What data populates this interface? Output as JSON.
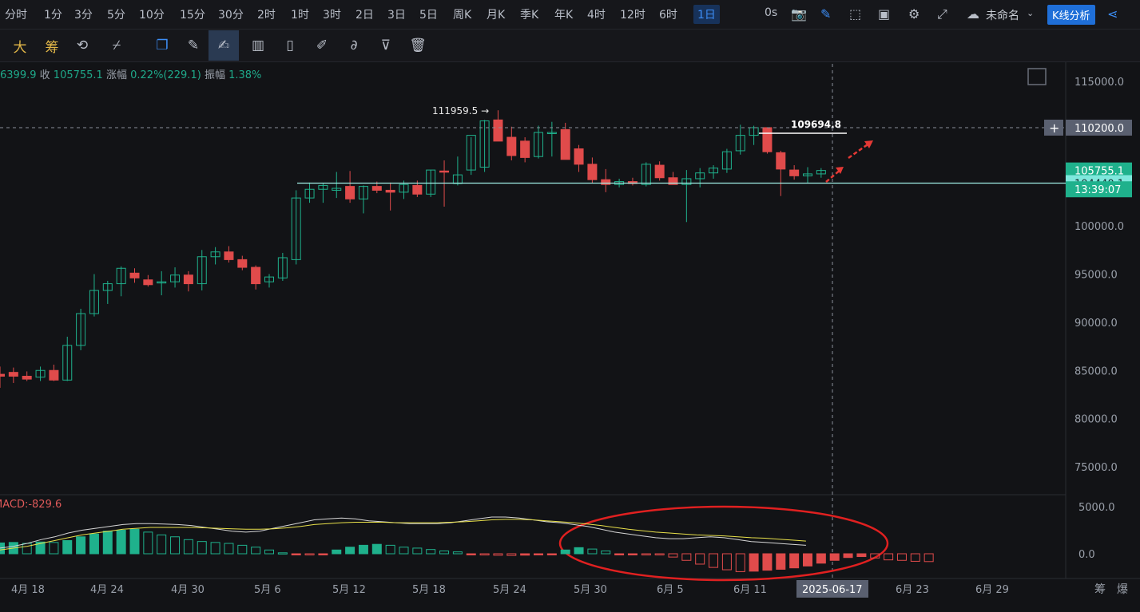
{
  "periods": [
    "分时",
    "1分",
    "3分",
    "5分",
    "10分",
    "15分",
    "30分",
    "2时",
    "1时",
    "3时",
    "2日",
    "3日",
    "5日",
    "周K",
    "月K",
    "季K",
    "年K",
    "4时",
    "12时",
    "6时",
    "1日"
  ],
  "active_period": "1日",
  "countdown": "0s",
  "layout_name": "未命名",
  "analysis_button": "K线分析",
  "tools": [
    {
      "name": "big-font-tool",
      "glyph": "大"
    },
    {
      "name": "chip-tool",
      "glyph": "筹"
    },
    {
      "name": "refresh-tool",
      "glyph": "⟲"
    },
    {
      "name": "crosshair-tool",
      "glyph": "⌿"
    },
    {
      "name": "copy-tool",
      "glyph": "❐"
    },
    {
      "name": "ruler-tool",
      "glyph": "✎"
    },
    {
      "name": "draw-line-tool",
      "glyph": "✍"
    },
    {
      "name": "candles-tool",
      "glyph": "▥"
    },
    {
      "name": "position-tool",
      "glyph": "▯"
    },
    {
      "name": "notes-tool",
      "glyph": "✐"
    },
    {
      "name": "magnet-tool",
      "glyph": "∂"
    },
    {
      "name": "filter-tool",
      "glyph": "⊽"
    },
    {
      "name": "delete-tool",
      "glyph": "🗑"
    }
  ],
  "info": {
    "open_label": "",
    "open_value": "6399.9",
    "close_label": "收",
    "close_value": "105755.1",
    "change_label": "涨幅",
    "change_value": "0.22%(229.1)",
    "amp_label": "振幅",
    "amp_value": "1.38%"
  },
  "colors": {
    "up": "#1fb18c",
    "down": "#e04b4b",
    "bg": "#121316",
    "ma1": "#d6d6d6",
    "ma2": "#e8e04a",
    "line": "#9ff0e6"
  },
  "chart_data": {
    "type": "candlestick",
    "price_axis": {
      "ticks": [
        115000,
        110000,
        105000,
        100000,
        95000,
        90000,
        85000,
        80000,
        75000
      ],
      "labels": [
        "115000.0",
        "110000.0",
        "105000.0",
        "100000.0",
        "95000.0",
        "90000.0",
        "85000.0",
        "80000.0",
        "75000.0"
      ],
      "ylim": [
        72000,
        117000
      ]
    },
    "time_axis": {
      "labels": [
        "4月 18",
        "4月 24",
        "4月 30",
        "5月 6",
        "5月 12",
        "5月 18",
        "5月 24",
        "5月 30",
        "6月 5",
        "6月 11",
        "2025-06-17",
        "6月 23",
        "6月 29"
      ]
    },
    "candles": [
      {
        "o": 84600,
        "h": 85400,
        "l": 83200,
        "c": 84400
      },
      {
        "o": 84800,
        "h": 85300,
        "l": 83700,
        "c": 84400
      },
      {
        "o": 84400,
        "h": 84900,
        "l": 83900,
        "c": 84100
      },
      {
        "o": 84300,
        "h": 85400,
        "l": 83900,
        "c": 85000
      },
      {
        "o": 85000,
        "h": 85600,
        "l": 83900,
        "c": 84000
      },
      {
        "o": 84000,
        "h": 88500,
        "l": 83900,
        "c": 87600
      },
      {
        "o": 87600,
        "h": 91400,
        "l": 87100,
        "c": 90900
      },
      {
        "o": 90900,
        "h": 95000,
        "l": 90600,
        "c": 93300
      },
      {
        "o": 93300,
        "h": 94300,
        "l": 91900,
        "c": 94000
      },
      {
        "o": 94000,
        "h": 95800,
        "l": 92700,
        "c": 95600
      },
      {
        "o": 95100,
        "h": 95600,
        "l": 94100,
        "c": 94600
      },
      {
        "o": 94400,
        "h": 94900,
        "l": 93700,
        "c": 93900
      },
      {
        "o": 94200,
        "h": 95300,
        "l": 92800,
        "c": 94200
      },
      {
        "o": 94200,
        "h": 95700,
        "l": 93600,
        "c": 94900
      },
      {
        "o": 94900,
        "h": 95300,
        "l": 93200,
        "c": 94000
      },
      {
        "o": 94000,
        "h": 97500,
        "l": 93300,
        "c": 96800
      },
      {
        "o": 96800,
        "h": 97800,
        "l": 96000,
        "c": 97300
      },
      {
        "o": 97300,
        "h": 97900,
        "l": 96200,
        "c": 96500
      },
      {
        "o": 96500,
        "h": 96900,
        "l": 95400,
        "c": 95700
      },
      {
        "o": 95700,
        "h": 95900,
        "l": 93400,
        "c": 94000
      },
      {
        "o": 94200,
        "h": 95000,
        "l": 93600,
        "c": 94700
      },
      {
        "o": 94600,
        "h": 97200,
        "l": 94300,
        "c": 96700
      },
      {
        "o": 96500,
        "h": 103700,
        "l": 96000,
        "c": 102900
      },
      {
        "o": 102900,
        "h": 104500,
        "l": 102400,
        "c": 103800
      },
      {
        "o": 103800,
        "h": 104400,
        "l": 102400,
        "c": 104200
      },
      {
        "o": 103700,
        "h": 105600,
        "l": 102900,
        "c": 103900
      },
      {
        "o": 104100,
        "h": 105700,
        "l": 102400,
        "c": 102800
      },
      {
        "o": 102800,
        "h": 104200,
        "l": 101300,
        "c": 104100
      },
      {
        "o": 104100,
        "h": 104600,
        "l": 103400,
        "c": 103700
      },
      {
        "o": 103700,
        "h": 104500,
        "l": 101600,
        "c": 103500
      },
      {
        "o": 103500,
        "h": 104700,
        "l": 102800,
        "c": 104300
      },
      {
        "o": 104200,
        "h": 104700,
        "l": 103000,
        "c": 103300
      },
      {
        "o": 103300,
        "h": 105800,
        "l": 103000,
        "c": 105800
      },
      {
        "o": 105700,
        "h": 106800,
        "l": 102000,
        "c": 105600
      },
      {
        "o": 104400,
        "h": 107200,
        "l": 104200,
        "c": 105300
      },
      {
        "o": 105800,
        "h": 109200,
        "l": 105300,
        "c": 109400
      },
      {
        "o": 106100,
        "h": 111000,
        "l": 105600,
        "c": 110900
      },
      {
        "o": 111000,
        "h": 112000,
        "l": 108900,
        "c": 108800
      },
      {
        "o": 109200,
        "h": 110300,
        "l": 106800,
        "c": 107300
      },
      {
        "o": 108800,
        "h": 109200,
        "l": 106600,
        "c": 107100
      },
      {
        "o": 107200,
        "h": 110400,
        "l": 107000,
        "c": 109700
      },
      {
        "o": 109600,
        "h": 110800,
        "l": 107200,
        "c": 109700
      },
      {
        "o": 110000,
        "h": 110700,
        "l": 107200,
        "c": 106900
      },
      {
        "o": 108000,
        "h": 108400,
        "l": 105600,
        "c": 106400
      },
      {
        "o": 106400,
        "h": 107100,
        "l": 104400,
        "c": 104800
      },
      {
        "o": 104800,
        "h": 105900,
        "l": 103500,
        "c": 104300
      },
      {
        "o": 104300,
        "h": 104900,
        "l": 104000,
        "c": 104600
      },
      {
        "o": 104600,
        "h": 105000,
        "l": 104200,
        "c": 104400
      },
      {
        "o": 104300,
        "h": 106600,
        "l": 104100,
        "c": 106400
      },
      {
        "o": 106300,
        "h": 106700,
        "l": 104700,
        "c": 105000
      },
      {
        "o": 105000,
        "h": 105600,
        "l": 104400,
        "c": 104300
      },
      {
        "o": 104300,
        "h": 105800,
        "l": 100400,
        "c": 104900
      },
      {
        "o": 104900,
        "h": 106000,
        "l": 104000,
        "c": 105500
      },
      {
        "o": 105500,
        "h": 106300,
        "l": 104900,
        "c": 106000
      },
      {
        "o": 105900,
        "h": 108000,
        "l": 105500,
        "c": 107700
      },
      {
        "o": 107800,
        "h": 110500,
        "l": 107400,
        "c": 109400
      },
      {
        "o": 109400,
        "h": 110400,
        "l": 108400,
        "c": 110200
      },
      {
        "o": 110200,
        "h": 110200,
        "l": 107500,
        "c": 107700
      },
      {
        "o": 107600,
        "h": 107800,
        "l": 103100,
        "c": 105900
      },
      {
        "o": 105800,
        "h": 106300,
        "l": 104800,
        "c": 105200
      },
      {
        "o": 105200,
        "h": 106100,
        "l": 104400,
        "c": 105400
      },
      {
        "o": 105400,
        "h": 106000,
        "l": 105000,
        "c": 105755.1
      }
    ],
    "annotations": {
      "high_label": "111959.5",
      "high_label_text": "111959.5 →",
      "horizontal_line_label": "109694.8",
      "horizontal_line_value": 109694.8,
      "support_line_value": 104440.1,
      "dashed_level": 110200,
      "crosshair_date": "2025-06-17"
    },
    "price_tags": [
      {
        "label": "110200.0",
        "value": 110200,
        "style": "crosshair"
      },
      {
        "label": "105755.1",
        "value": 105755.1,
        "style": "current"
      },
      {
        "label": "104440.1",
        "value": 104440.1,
        "style": "line"
      },
      {
        "label": "13:39:07",
        "value": 103800,
        "style": "countdown"
      }
    ],
    "macd": {
      "label": "MACD:-829.6",
      "axis": {
        "labels": [
          "5000.0",
          "0.0"
        ],
        "ticks": [
          5000,
          0
        ],
        "ylim": [
          -2000,
          6000
        ]
      },
      "hist": [
        1150,
        1200,
        1100,
        1250,
        1200,
        1400,
        1800,
        2100,
        2400,
        2500,
        2600,
        2300,
        2000,
        1800,
        1500,
        1300,
        1200,
        1100,
        900,
        700,
        400,
        100,
        -50,
        -60,
        -40,
        400,
        700,
        900,
        1000,
        900,
        700,
        600,
        450,
        300,
        200,
        -80,
        -130,
        -160,
        -180,
        -150,
        -120,
        -110,
        400,
        650,
        500,
        300,
        -50,
        -40,
        -50,
        -60,
        -350,
        -700,
        -1100,
        -1450,
        -1700,
        -1900,
        -1850,
        -1750,
        -1650,
        -1500,
        -1300,
        -1000,
        -700,
        -400,
        -300,
        -450,
        -650,
        -700,
        -800,
        -829.6
      ],
      "dif": [
        600,
        800,
        1100,
        1500,
        1800,
        2200,
        2500,
        2700,
        2900,
        3100,
        3200,
        3200,
        3150,
        3100,
        3000,
        2800,
        2600,
        2400,
        2300,
        2400,
        2700,
        3000,
        3300,
        3600,
        3700,
        3800,
        3700,
        3500,
        3400,
        3300,
        3200,
        3200,
        3200,
        3300,
        3500,
        3700,
        3900,
        3900,
        3800,
        3600,
        3400,
        3300,
        3100,
        2900,
        2600,
        2300,
        2100,
        1900,
        1700,
        1600,
        1600,
        1700,
        1800,
        1700,
        1500,
        1300,
        1200,
        1100,
        1000,
        900
      ],
      "dea": [
        400,
        600,
        800,
        1100,
        1400,
        1700,
        2000,
        2200,
        2400,
        2600,
        2700,
        2800,
        2800,
        2800,
        2800,
        2750,
        2700,
        2650,
        2600,
        2600,
        2650,
        2750,
        2900,
        3100,
        3200,
        3300,
        3350,
        3350,
        3350,
        3300,
        3300,
        3300,
        3300,
        3350,
        3400,
        3500,
        3600,
        3650,
        3650,
        3600,
        3500,
        3400,
        3300,
        3150,
        3000,
        2800,
        2600,
        2450,
        2300,
        2200,
        2100,
        2000,
        1950,
        1900,
        1800,
        1700,
        1650,
        1550,
        1450,
        1350
      ]
    }
  }
}
